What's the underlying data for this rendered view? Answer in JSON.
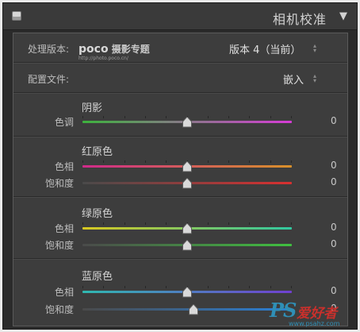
{
  "header": {
    "title": "相机校准",
    "collapse_glyph": "▼"
  },
  "process": {
    "label": "处理版本:",
    "value": "版本 4（当前）"
  },
  "logo": {
    "brand": "poco",
    "brand_cn": "摄影专题",
    "url": "http://photo.poco.cn/"
  },
  "profile": {
    "label": "配置文件:",
    "value": "嵌入"
  },
  "sections": [
    {
      "title": "阴影",
      "sliders": [
        {
          "label": "色调",
          "value": "0",
          "position": 0.5
        }
      ]
    },
    {
      "title": "红原色",
      "sliders": [
        {
          "label": "色相",
          "value": "0",
          "position": 0.5
        },
        {
          "label": "饱和度",
          "value": "0",
          "position": 0.5
        }
      ]
    },
    {
      "title": "绿原色",
      "sliders": [
        {
          "label": "色相",
          "value": "0",
          "position": 0.5
        },
        {
          "label": "饱和度",
          "value": "0",
          "position": 0.5
        }
      ]
    },
    {
      "title": "蓝原色",
      "sliders": [
        {
          "label": "色相",
          "value": "0",
          "position": 0.5
        },
        {
          "label": "饱和度",
          "value": "0",
          "position": 0.53
        }
      ]
    }
  ],
  "watermark": {
    "ps": "PS",
    "cn": "爱好者",
    "url": "www.psahz.com"
  },
  "colors": {
    "shadow_tint": [
      "#3db23d",
      "#d63cd6"
    ],
    "red_hue": [
      "#d02a8a",
      "#d8902a"
    ],
    "red_sat": [
      "#4a4a4a",
      "#d83030"
    ],
    "green_hue": [
      "#d8c820",
      "#30c8a0"
    ],
    "green_sat": [
      "#4a4a4a",
      "#40c040"
    ],
    "blue_hue": [
      "#30b8b0",
      "#7040d0"
    ],
    "blue_sat": [
      "#4a4a4a",
      "#2a80d8"
    ]
  }
}
